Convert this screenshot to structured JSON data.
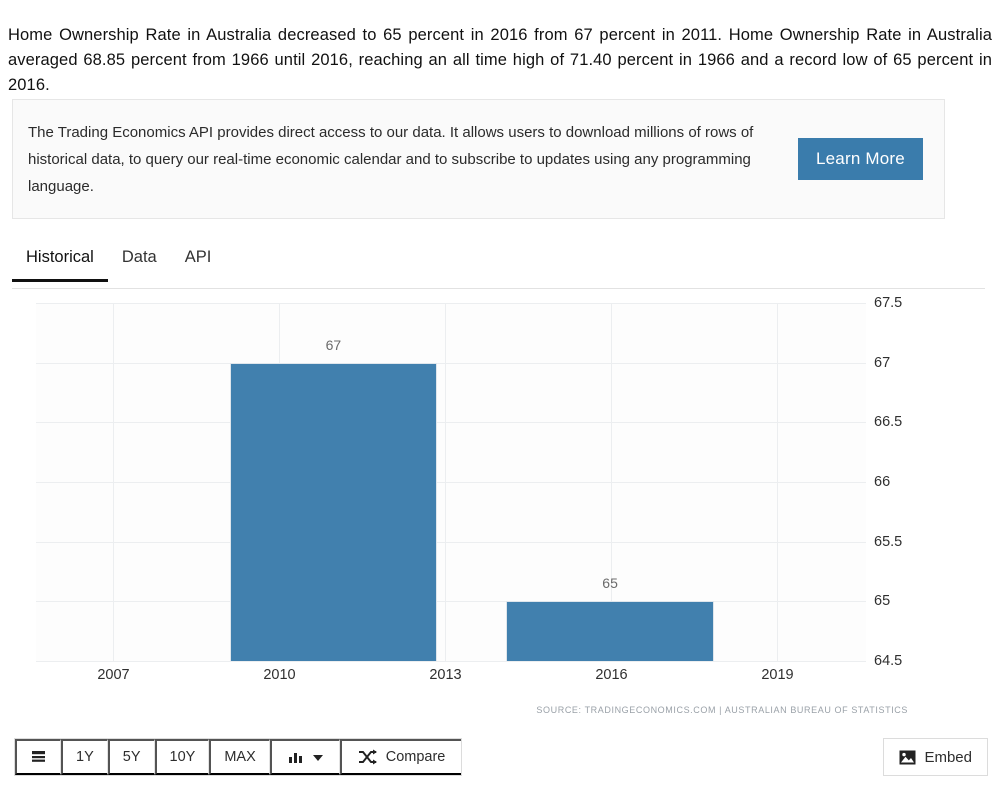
{
  "intro": {
    "paragraph": "Home Ownership Rate in Australia decreased to 65 percent in 2016 from 67 percent in 2011. Home Ownership Rate in Australia averaged 68.85 percent from 1966 until 2016, reaching an all time high of 71.40 percent in 1966 and a record low of 65 percent in 2016."
  },
  "api_banner": {
    "text": "The Trading Economics API provides direct access to our data. It allows users to download millions of rows of historical data, to query our real-time economic calendar and to subscribe to updates using any programming language.",
    "button_label": "Learn More",
    "button_color": "#3a7cac"
  },
  "tabs": [
    {
      "label": "Historical",
      "active": true
    },
    {
      "label": "Data",
      "active": false
    },
    {
      "label": "API",
      "active": false
    }
  ],
  "chart_data": {
    "type": "bar",
    "title": "",
    "xlabel": "",
    "ylabel": "",
    "categories": [
      "2011",
      "2016"
    ],
    "values": [
      67,
      65
    ],
    "bar_color": "#4180ae",
    "grid": true,
    "legend": null,
    "ylim": [
      64.5,
      67.5
    ],
    "ytick_labels": [
      "67.5",
      "67",
      "66.5",
      "66",
      "65.5",
      "65",
      "64.5"
    ],
    "ytick_values": [
      67.5,
      67,
      66.5,
      66,
      65.5,
      65,
      64.5
    ],
    "xtick_labels": [
      "2007",
      "2010",
      "2013",
      "2016",
      "2019"
    ],
    "xtick_values": [
      2007,
      2010,
      2013,
      2016,
      2019
    ],
    "xlim": [
      2005.6,
      2020.6
    ],
    "data_labels": [
      "67",
      "65"
    ],
    "annotation": "SOURCE: TRADINGECONOMICS.COM  |  AUSTRALIAN BUREAU OF STATISTICS"
  },
  "toolbar": {
    "list_label": "",
    "ranges": [
      "1Y",
      "5Y",
      "10Y",
      "MAX"
    ],
    "chart_type_label": "",
    "compare_label": "Compare",
    "embed_label": "Embed"
  }
}
